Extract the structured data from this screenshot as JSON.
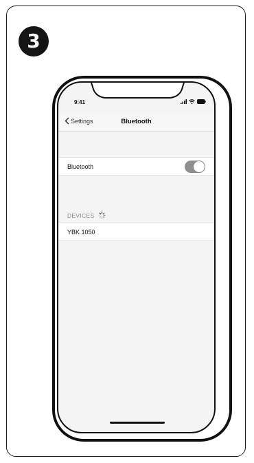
{
  "step": {
    "number": "3"
  },
  "status_bar": {
    "time": "9:41"
  },
  "navbar": {
    "back_label": "Settings",
    "title": "Bluetooth"
  },
  "bluetooth": {
    "label": "Bluetooth",
    "enabled": true
  },
  "devices": {
    "header": "DEVICES",
    "items": [
      {
        "name": "YBK 1050"
      }
    ]
  },
  "icons": {
    "back": "chevron-left-icon",
    "signal": "cellular-signal-icon",
    "wifi": "wifi-icon",
    "battery": "battery-icon",
    "spinner": "loading-spinner-icon"
  }
}
